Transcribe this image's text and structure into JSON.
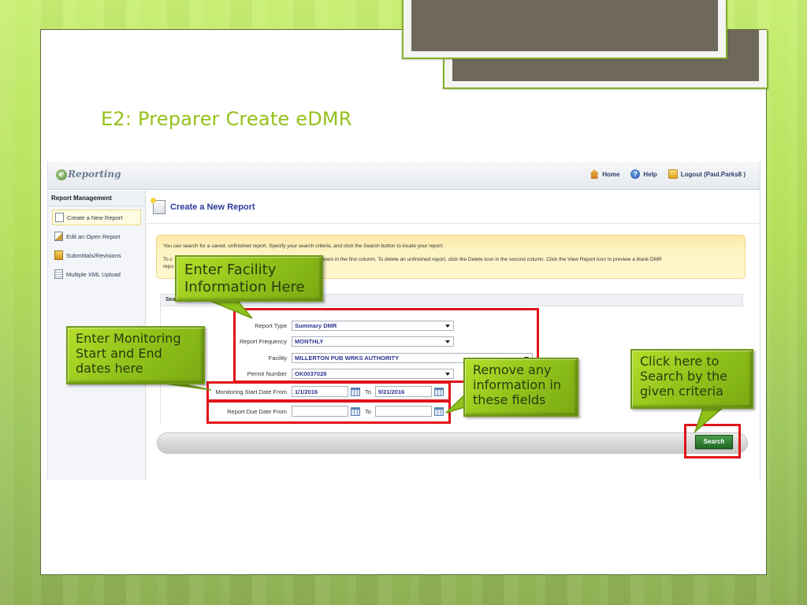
{
  "slide": {
    "title": "E2: Preparer Create eDMR"
  },
  "app": {
    "logo": "Reporting",
    "top_nav": [
      {
        "label": "Home",
        "icon": "home-icon"
      },
      {
        "label": "Help",
        "icon": "help-icon"
      },
      {
        "label": "Logout (Paul.Parks8 )",
        "icon": "logout-icon"
      }
    ],
    "sidebar": {
      "heading": "Report Management",
      "items": [
        {
          "label": "Create a New Report",
          "icon": "document-icon",
          "active": true
        },
        {
          "label": "Edit an Open Report",
          "icon": "edit-document-icon",
          "active": false
        },
        {
          "label": "Submittals/Revisions",
          "icon": "submittals-icon",
          "active": false
        },
        {
          "label": "Multiple XML Upload",
          "icon": "xml-upload-icon",
          "active": false
        }
      ]
    },
    "page_title": "Create a New Report",
    "info": {
      "line1": "You can search for a saved, unfinished report. Specify your search criteria, and click the Search button to locate your report.",
      "line2_start": "To c",
      "line2_end": "n shown in the first column. To delete an unfinished report, click the Delete icon in the second column. Click the View Report icon to preview a blank DMR",
      "line3_start": "repo"
    },
    "search_options_heading": "Search Options",
    "form": {
      "report_type": {
        "label": "Report Type",
        "value": "Summary DMR"
      },
      "report_frequency": {
        "label": "Report Frequency",
        "value": "MONTHLY"
      },
      "facility": {
        "label": "Facility",
        "value": "MILLERTON PUB WRKS AUTHORITY"
      },
      "permit_number": {
        "label": "Permit Number",
        "value": "OK0037028"
      },
      "monitoring_start": {
        "label": "Monitoring Start Date From",
        "from": "1/1/2016",
        "to_label": "To",
        "to": "9/21/2016"
      },
      "report_due": {
        "label": "Report Due Date From",
        "from": "",
        "to_label": "To",
        "to": ""
      }
    },
    "search_button": "Search"
  },
  "annotations": {
    "facility": [
      "Enter Facility",
      "Information Here"
    ],
    "monitoring": [
      "Enter Monitoring",
      "Start and End",
      "dates here"
    ],
    "remove": [
      "Remove any",
      "information in",
      "these fields"
    ],
    "search": [
      "Click here to",
      "Search by the",
      "given criteria"
    ]
  },
  "colors": {
    "accent_green": "#94c11c",
    "highlight_red": "#e0141b",
    "link_blue": "#2b3a9c",
    "search_button_green": "#1f6b24"
  }
}
